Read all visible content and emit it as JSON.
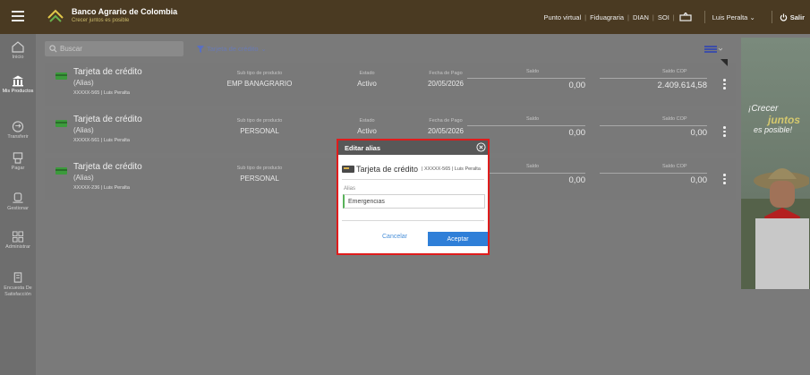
{
  "header": {
    "brand_name": "Banco Agrario de Colombia",
    "brand_slogan": "Crecer juntos es posible",
    "links": [
      "Punto virtual",
      "Fiduagraria",
      "DIAN",
      "SOI"
    ],
    "user": "Luis Peralta",
    "logout": "Salir"
  },
  "sidebar": {
    "items": [
      {
        "label": "Inicio"
      },
      {
        "label": "Mis Productos"
      },
      {
        "label": "Transferir"
      },
      {
        "label": "Pagar"
      },
      {
        "label": "Gestionar"
      },
      {
        "label": "Administrar"
      },
      {
        "label": "Encuesta De Satisfacción"
      }
    ]
  },
  "toolbar": {
    "search_placeholder": "Buscar",
    "filter_label": "Tarjeta de crédito"
  },
  "column_labels": {
    "subtype": "Sub tipo de producto",
    "state": "Estado",
    "due_date": "Fecha de Pago",
    "balance": "Saldo",
    "balance_cop": "Saldo COP"
  },
  "cards": [
    {
      "title": "Tarjeta de crédito",
      "alias": "(Alias)",
      "account": "XXXXX-565 | Luis Peralta",
      "subtype": "EMP BANAGRARIO",
      "state": "Activo",
      "due_date": "20/05/2026",
      "balance": "0,00",
      "balance_cop": "2.409.614,58"
    },
    {
      "title": "Tarjeta de crédito",
      "alias": "(Alias)",
      "account": "XXXXX-561 | Luis Peralta",
      "subtype": "PERSONAL",
      "state": "Activo",
      "due_date": "20/05/2026",
      "balance": "0,00",
      "balance_cop": "0,00"
    },
    {
      "title": "Tarjeta de crédito",
      "alias": "(Alias)",
      "account": "XXXXX-236 | Luis Peralta",
      "subtype": "PERSONAL",
      "state": "",
      "due_date": "",
      "balance": "0,00",
      "balance_cop": "0,00"
    }
  ],
  "banner": {
    "line1": "¡Crecer",
    "line2": "juntos",
    "line3": "es posible!"
  },
  "modal": {
    "title": "Editar alias",
    "product_name": "Tarjeta de crédito",
    "product_sub": "| XXXXX-565 | Luis Peralta",
    "field_label": "Alias",
    "field_value": "Emergencias",
    "cancel_label": "Cancelar",
    "accept_label": "Aceptar"
  },
  "colors": {
    "topbar": "#4a3a22",
    "primary_button": "#2f7fd8",
    "highlight_border": "#e01c1c",
    "card_icon": "#3c9a3c"
  }
}
